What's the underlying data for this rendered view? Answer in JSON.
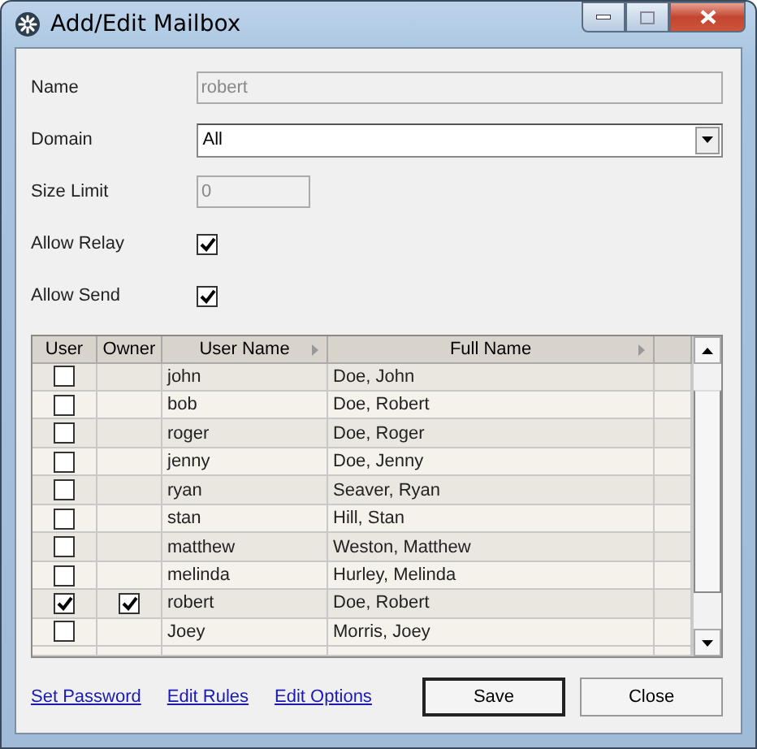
{
  "window": {
    "title": "Add/Edit Mailbox"
  },
  "fields": [
    {
      "kind": "text",
      "label": "Name",
      "value": "robert",
      "disabled": true
    },
    {
      "kind": "select",
      "label": "Domain",
      "value": "All",
      "disabled": false
    },
    {
      "kind": "number",
      "label": "Size Limit",
      "value": "0",
      "disabled": true
    },
    {
      "kind": "checkbox",
      "label": "Allow Relay",
      "checked": true
    },
    {
      "kind": "checkbox",
      "label": "Allow Send",
      "checked": true
    }
  ],
  "table": {
    "columns": [
      "User",
      "Owner",
      "User Name",
      "Full Name"
    ],
    "rows": [
      {
        "user": false,
        "owner": false,
        "user_name": "john",
        "full_name": "Doe, John"
      },
      {
        "user": false,
        "owner": false,
        "user_name": "bob",
        "full_name": "Doe, Robert"
      },
      {
        "user": false,
        "owner": false,
        "user_name": "roger",
        "full_name": "Doe, Roger"
      },
      {
        "user": false,
        "owner": false,
        "user_name": "jenny",
        "full_name": "Doe, Jenny"
      },
      {
        "user": false,
        "owner": false,
        "user_name": "ryan",
        "full_name": "Seaver, Ryan"
      },
      {
        "user": false,
        "owner": false,
        "user_name": "stan",
        "full_name": "Hill, Stan"
      },
      {
        "user": false,
        "owner": false,
        "user_name": "matthew",
        "full_name": "Weston, Matthew"
      },
      {
        "user": false,
        "owner": false,
        "user_name": "melinda",
        "full_name": "Hurley, Melinda"
      },
      {
        "user": true,
        "owner": true,
        "user_name": "robert",
        "full_name": "Doe, Robert"
      },
      {
        "user": false,
        "owner": false,
        "user_name": "Joey",
        "full_name": "Morris, Joey"
      }
    ]
  },
  "links": [
    "Set Password",
    "Edit Rules",
    "Edit Options"
  ],
  "buttons": [
    {
      "label": "Save",
      "default": true
    },
    {
      "label": "Close",
      "default": false
    }
  ]
}
